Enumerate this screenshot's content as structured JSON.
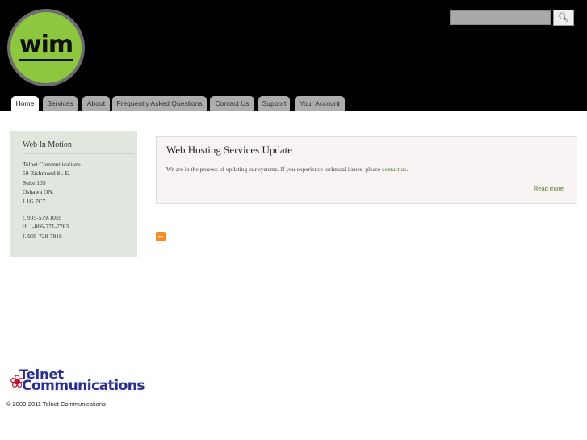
{
  "header": {
    "logo_text": "wim",
    "search_placeholder": "",
    "search_button_icon": "search-icon"
  },
  "nav": {
    "tabs": [
      {
        "label": "Home",
        "active": true
      },
      {
        "label": "Services"
      },
      {
        "label": "About"
      },
      {
        "label": "Frequently Asked Questions"
      },
      {
        "label": "Contact Us"
      },
      {
        "label": "Support"
      },
      {
        "label": "Your Account"
      }
    ]
  },
  "sidebar": {
    "title": "Web In Motion",
    "address": [
      "Telnet Communications",
      "50 Richmond St. E.",
      "Suite 105",
      "Oshawa ON.",
      "L1G 7C7"
    ],
    "phones": [
      "t. 905-579-1059",
      "tf. 1-866-771-7763",
      "f. 905-728-7918"
    ]
  },
  "article": {
    "title": "Web Hosting Services Update",
    "body": "We are in the process of updating our systems. If you experience technical issues, please ",
    "link": "contact us",
    "after_link": ".",
    "read_more": "Read more"
  },
  "footer": {
    "logo_line1": "Telnet",
    "logo_line2": "Communications",
    "copyright": "© 2009-2011  Telnet Communications"
  }
}
